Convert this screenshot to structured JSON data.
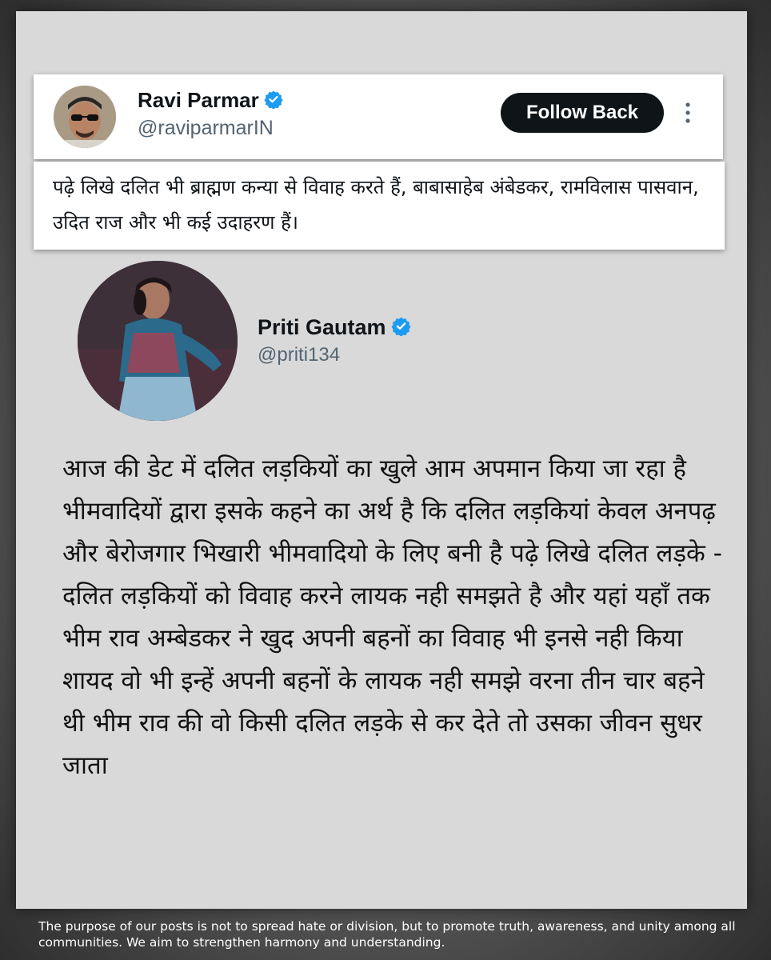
{
  "quoted_user": {
    "name": "Ravi Parmar",
    "handle": "@raviparmarIN",
    "follow_label": "Follow Back",
    "tweet_text": "पढ़े लिखे दलित भी ब्राह्मण कन्या से विवाह करते हैं, बाबासाहेब अंबेडकर, रामविलास पासवान, उदित राज और भी कई उदाहरण हैं।"
  },
  "main_user": {
    "name": "Priti Gautam",
    "handle": "@priti134",
    "tweet_text": "आज की डेट में दलित लड़कियों का खुले आम अपमान किया जा रहा है भीमवादियों द्वारा इसके कहने का अर्थ है कि दलित लड़कियां केवल अनपढ़ और बेरोजगार भिखारी भीमवादियो  के लिए बनी है पढ़े लिखे दलित लड़के - दलित लड़कियों को विवाह करने लायक नही समझते है और यहां यहाँ तक भीम राव अम्बेडकर ने खुद अपनी बहनों का विवाह भी इनसे नही किया शायद वो भी इन्हें अपनी बहनों के लायक नही समझे वरना तीन चार बहने थी भीम राव की वो किसी दलित लड़के से कर देते तो उसका जीवन सुधर जाता"
  },
  "footer": {
    "disclaimer": "The purpose of our posts is not to spread hate or division, but to promote truth, awareness, and unity among all communities. We aim to strengthen harmony and understanding."
  },
  "colors": {
    "verified_blue": "#1d9bf0",
    "button_bg": "#0f1419",
    "card_bg": "#d9d9d9"
  },
  "icons": {
    "verified": "verified-badge-icon",
    "more": "more-vertical-icon"
  }
}
